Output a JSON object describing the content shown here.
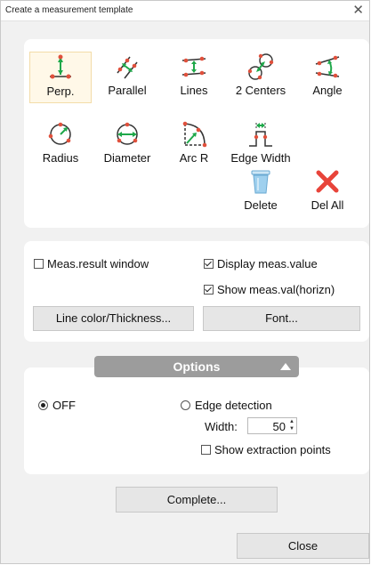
{
  "window": {
    "title": "Create a measurement template",
    "close_glyph": "✕"
  },
  "tools": [
    {
      "id": "perp",
      "label": "Perp.",
      "icon": "perpendicular-icon",
      "selected": true
    },
    {
      "id": "parallel",
      "label": "Parallel",
      "icon": "parallel-icon"
    },
    {
      "id": "lines",
      "label": "Lines",
      "icon": "lines-icon"
    },
    {
      "id": "2centers",
      "label": "2 Centers",
      "icon": "two-centers-icon"
    },
    {
      "id": "angle",
      "label": "Angle",
      "icon": "angle-icon"
    },
    {
      "id": "radius",
      "label": "Radius",
      "icon": "radius-icon"
    },
    {
      "id": "diameter",
      "label": "Diameter",
      "icon": "diameter-icon"
    },
    {
      "id": "arcr",
      "label": "Arc R",
      "icon": "arc-radius-icon"
    },
    {
      "id": "edgewidth",
      "label": "Edge Width",
      "icon": "edge-width-icon"
    },
    {
      "id": "delete",
      "label": "Delete",
      "icon": "trash-icon"
    },
    {
      "id": "delall",
      "label": "Del All",
      "icon": "delete-all-x-icon"
    }
  ],
  "display": {
    "meas_result_window": {
      "label": "Meas.result window",
      "checked": false
    },
    "display_meas_value": {
      "label": "Display meas.value",
      "checked": true
    },
    "show_meas_val_horizn": {
      "label": "Show meas.val(horizn)",
      "checked": true
    },
    "line_color_button": "Line color/Thickness...",
    "font_button": "Font..."
  },
  "options": {
    "header": "Options",
    "off": {
      "label": "OFF",
      "checked": true
    },
    "edge_detection": {
      "label": "Edge detection",
      "checked": false
    },
    "width_label": "Width:",
    "width_value": "50",
    "show_extraction_points": {
      "label": "Show extraction points",
      "checked": false
    }
  },
  "footer": {
    "complete_button": "Complete...",
    "close_button": "Close"
  },
  "colors": {
    "accent_green": "#1fa84a",
    "point_red": "#e0503c",
    "icon_dark": "#333333",
    "delete_red": "#e8443a",
    "trash_blue": "#9fd0ee"
  }
}
